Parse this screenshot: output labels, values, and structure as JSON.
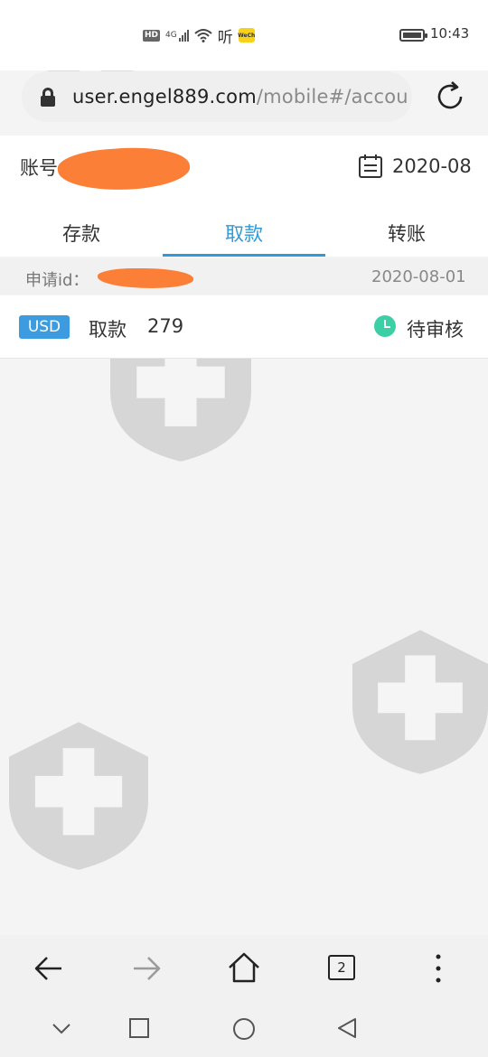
{
  "status_bar": {
    "time": "10:43",
    "network_badge": "HD",
    "network_type": "4G",
    "listen_label": "听",
    "app_badge": "WeCh"
  },
  "browser": {
    "url_host": "user.engel889.com",
    "url_path": "/mobile#/accou",
    "lock_icon": "lock-icon",
    "reload_icon": "reload-icon",
    "tab_count": "2",
    "nav_buttons": [
      "back-arrow-icon",
      "forward-arrow-icon",
      "home-icon",
      "tabs-icon",
      "more-icon"
    ]
  },
  "header": {
    "account_label": "账号",
    "date_filter": "2020-08"
  },
  "tabs": [
    {
      "label": "存款",
      "active": false
    },
    {
      "label": "取款",
      "active": true
    },
    {
      "label": "转账",
      "active": false
    }
  ],
  "records": {
    "request_id_label": "申请id：",
    "request_date": "2020-08-01",
    "currency": "USD",
    "type": "取款",
    "amount": "279",
    "status": "待审核"
  },
  "colors": {
    "accent": "#2f9ad6",
    "badge": "#3d9be0",
    "status_icon": "#3ccfa6",
    "redaction": "#fb7f36",
    "watermark": "#d3d3d3"
  },
  "system_nav": [
    "chevron-down-icon",
    "square-icon",
    "circle-icon",
    "triangle-back-icon"
  ]
}
